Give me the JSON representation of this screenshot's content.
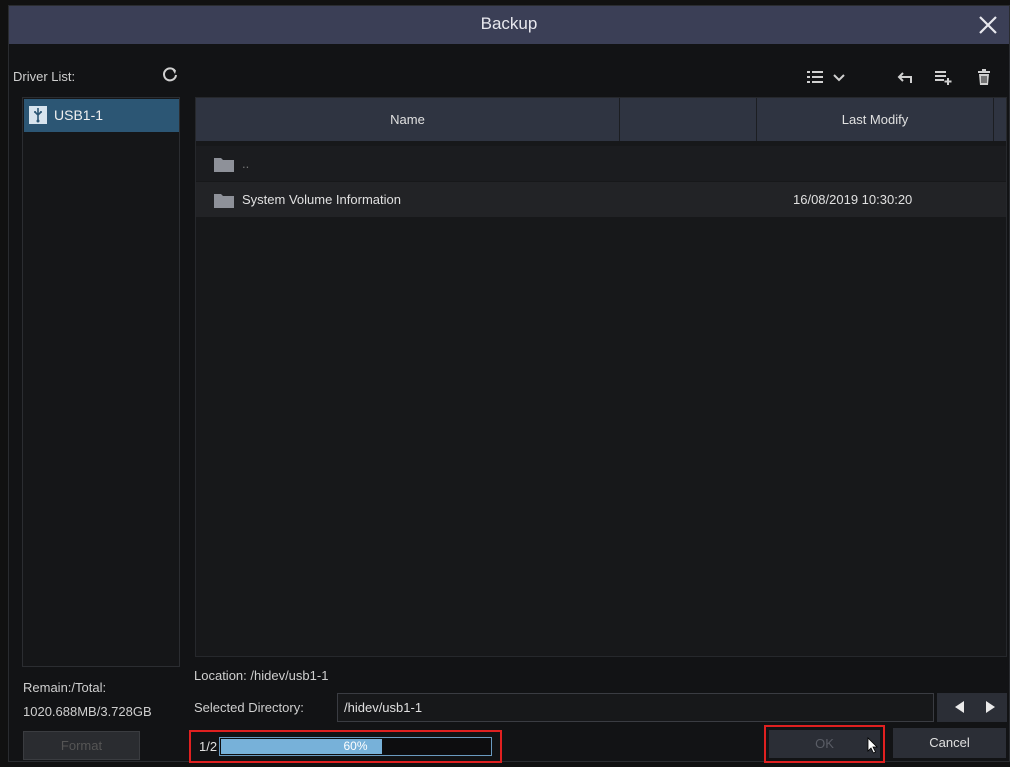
{
  "window": {
    "title": "Backup"
  },
  "drivers": {
    "label": "Driver List:",
    "items": [
      {
        "label": "USB1-1",
        "selected": true
      }
    ]
  },
  "storage": {
    "label": "Remain:/Total:",
    "value": "1020.688MB/3.728GB",
    "format_label": "Format"
  },
  "toolbar": {
    "icons": [
      "list-view-icon",
      "chevron-down-icon",
      "back-icon",
      "new-folder-icon",
      "delete-icon"
    ]
  },
  "files": {
    "columns": [
      "Name",
      "",
      "Last Modify",
      ""
    ],
    "rows": [
      {
        "name": "..",
        "modified": ""
      },
      {
        "name": "System Volume Information",
        "modified": "16/08/2019 10:30:20"
      }
    ]
  },
  "location": {
    "text": "Location: /hidev/usb1-1"
  },
  "selected_directory": {
    "label": "Selected Directory:",
    "value": "/hidev/usb1-1"
  },
  "progress": {
    "count": "1/2",
    "percent": 60,
    "label": "60%"
  },
  "buttons": {
    "ok": "OK",
    "cancel": "Cancel"
  },
  "colors": {
    "titlebar": "#3b3f56",
    "selection": "#2c5674",
    "progress": "#77b1d9",
    "highlight_box": "#e02020"
  }
}
